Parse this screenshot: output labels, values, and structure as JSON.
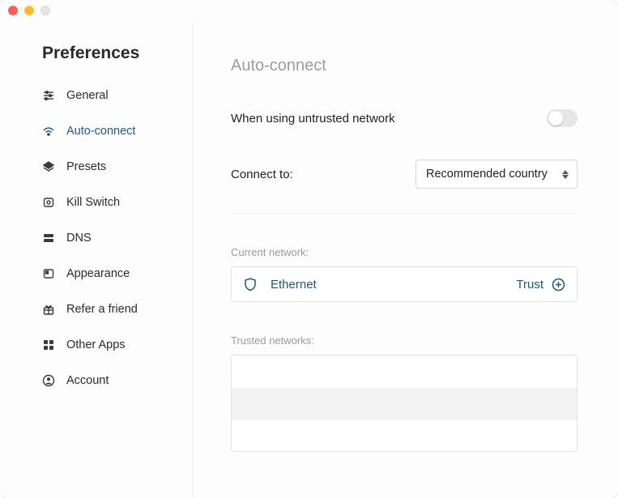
{
  "sidebar": {
    "title": "Preferences",
    "items": [
      {
        "label": "General",
        "active": false
      },
      {
        "label": "Auto-connect",
        "active": true
      },
      {
        "label": "Presets",
        "active": false
      },
      {
        "label": "Kill Switch",
        "active": false
      },
      {
        "label": "DNS",
        "active": false
      },
      {
        "label": "Appearance",
        "active": false
      },
      {
        "label": "Refer a friend",
        "active": false
      },
      {
        "label": "Other Apps",
        "active": false
      },
      {
        "label": "Account",
        "active": false
      }
    ]
  },
  "page": {
    "title": "Auto-connect",
    "untrusted_label": "When using untrusted network",
    "untrusted_on": false,
    "connect_to_label": "Connect to:",
    "connect_to_value": "Recommended country",
    "current_network_label": "Current network:",
    "current_network_name": "Ethernet",
    "trust_action": "Trust",
    "trusted_networks_label": "Trusted networks:",
    "trusted_networks": []
  }
}
